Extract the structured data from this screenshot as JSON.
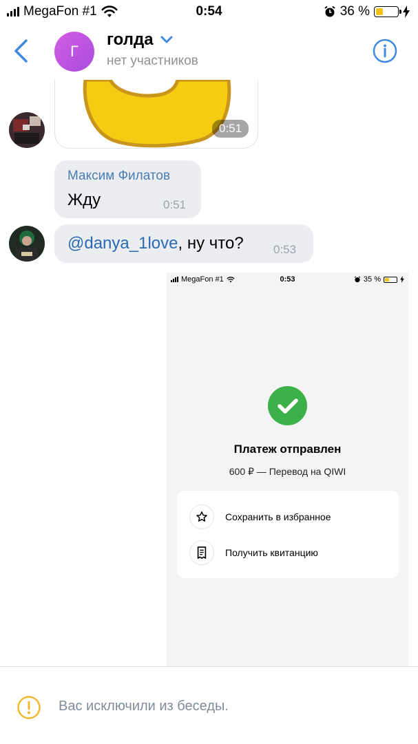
{
  "status_bar": {
    "carrier": "MegaFon #1",
    "time": "0:54",
    "battery": "36 %",
    "battery_level": 0.36
  },
  "header": {
    "avatar_letter": "Г",
    "title": "голда",
    "subtitle": "нет участников"
  },
  "messages": [
    {
      "type": "sticker",
      "time": "0:51"
    },
    {
      "type": "text",
      "sender": "Максим Филатов",
      "text": "Жду",
      "time": "0:51"
    },
    {
      "type": "text",
      "mention": "@danya_1love",
      "text": ", ну что?",
      "time": "0:53"
    },
    {
      "type": "image",
      "screenshot": {
        "status_bar": {
          "carrier": "MegaFon #1",
          "time": "0:53",
          "battery": "35 %"
        },
        "title": "Платеж отправлен",
        "subtitle": "600 ₽ — Перевод на QIWI",
        "actions": [
          {
            "label": "Сохранить в избранное",
            "icon": "star-icon"
          },
          {
            "label": "Получить квитанцию",
            "icon": "receipt-icon"
          }
        ]
      }
    }
  ],
  "footer": {
    "notice": "Вас исключили из беседы."
  },
  "colors": {
    "accent": "#4a7db2",
    "bubble": "#ebedf0",
    "success": "#3cb14a",
    "avatar": "#c056e3"
  }
}
